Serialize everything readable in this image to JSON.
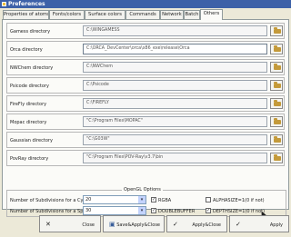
{
  "window": {
    "title": "Preferences"
  },
  "tabs": [
    {
      "label": "Properties of atoms"
    },
    {
      "label": "Fonts/colors"
    },
    {
      "label": "Surface colors"
    },
    {
      "label": "Commands"
    },
    {
      "label": "Network"
    },
    {
      "label": "Batch"
    },
    {
      "label": "Others"
    }
  ],
  "directories": [
    {
      "label": "Gamess directory",
      "value": "C:\\WINGAMESS"
    },
    {
      "label": "Orca directory",
      "value": "C:\\ORCA_DevCenter\\orca\\x86_exe\\release\\Orca"
    },
    {
      "label": "NWChem directory",
      "value": "C:\\NWChem"
    },
    {
      "label": "Psicode directory",
      "value": "C:\\Psicode"
    },
    {
      "label": "FireFly directory",
      "value": "C:\\FIREFLY"
    },
    {
      "label": "Mopac directory",
      "value": "\"C:\\Program Files\\MOPAC\""
    },
    {
      "label": "Gaussian directory",
      "value": "\"C:\\G03W\""
    },
    {
      "label": "PovRay directory",
      "value": "\"C:\\Program Files\\POV-Ray\\v3.7\\bin"
    }
  ],
  "opengl": {
    "legend": "OpenGL Options",
    "cylinder_label": "Number of Subdivisions for a Cylinder",
    "cylinder_value": "20",
    "sphere_label": "Number of Subdivisions for a Sphere",
    "sphere_value": "30",
    "rgba_label": "RGBA",
    "doublebuffer_label": "DOUBLEBUFFER",
    "alphasize_label": "ALPHASIZE=1(0 if not)",
    "depthsize_label": "DEPTHSIZE=1(0 if not)",
    "rgba_checked": true,
    "doublebuffer_checked": true,
    "alphasize_checked": false,
    "depthsize_checked": true
  },
  "buttons": {
    "close": "Close",
    "save_apply_close": "Save&Apply&Close",
    "apply_close": "Apply&Close",
    "apply": "Apply"
  },
  "icons": {
    "browse": "folder-icon",
    "close": "x-icon",
    "save": "disk-icon",
    "check": "check-icon"
  },
  "colors": {
    "titlebar": "#3d61a8",
    "window_bg": "#ece9d8",
    "panel_bg": "#fbfbf8"
  }
}
